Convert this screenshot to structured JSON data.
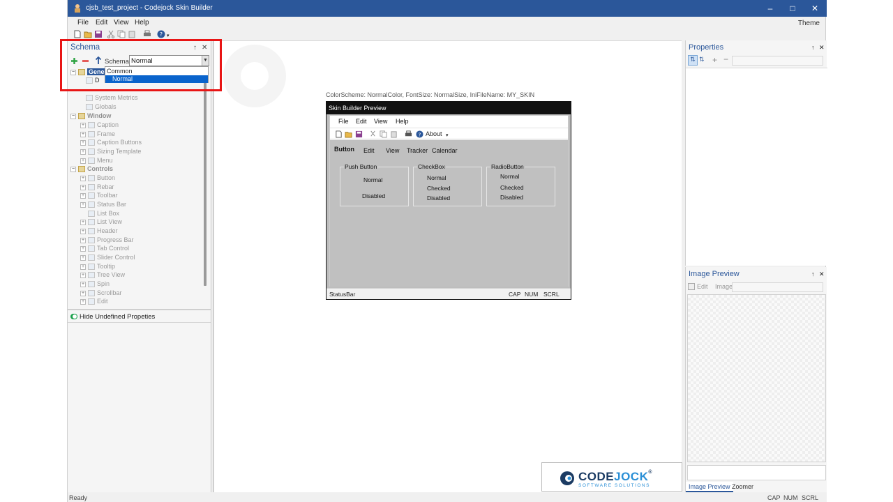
{
  "window": {
    "title": "cjsb_test_project - Codejock Skin Builder",
    "minimize": "–",
    "maximize": "□",
    "close": "✕"
  },
  "menu": [
    "File",
    "Edit",
    "View",
    "Help"
  ],
  "theme_label": "Theme",
  "schema_pane": {
    "title": "Schema",
    "pin": "↑",
    "close": "✕",
    "schema_label": "Schema:",
    "schema_value": "Normal",
    "dropdown_options": [
      "Common",
      "Normal"
    ],
    "tree": {
      "general_selected": "Gene",
      "child_partial": "D",
      "system_metrics": "System Metrics",
      "globals": "Globals",
      "window_group": "Window",
      "window_items": [
        "Caption",
        "Frame",
        "Caption Buttons",
        "Sizing Template",
        "Menu"
      ],
      "controls_group": "Controls",
      "control_items": [
        "Button",
        "Rebar",
        "Toolbar",
        "Status Bar",
        "List Box",
        "List View",
        "Header",
        "Progress Bar",
        "Tab Control",
        "Slider Control",
        "Tooltip",
        "Tree View",
        "Spin",
        "Scrollbar",
        "Edit"
      ]
    },
    "hide_undefined": "Hide Undefined Propeties"
  },
  "center": {
    "color_scheme": "ColorScheme: NormalColor, FontSize: NormalSize, IniFileName: MY_SKIN",
    "preview": {
      "title": "Skin Builder Preview",
      "menu": [
        "File",
        "Edit",
        "View",
        "Help"
      ],
      "about": "About",
      "tabs": [
        "Button",
        "Edit",
        "View",
        "Tracker",
        "Calendar"
      ],
      "push_button": {
        "title": "Push Button",
        "items": [
          "Normal",
          "Disabled"
        ]
      },
      "checkbox": {
        "title": "CheckBox",
        "items": [
          "Normal",
          "Checked",
          "Disabled"
        ]
      },
      "radio": {
        "title": "RadioButton",
        "items": [
          "Normal",
          "Checked",
          "Disabled"
        ]
      },
      "status": {
        "left": "StatusBar",
        "cap": "CAP",
        "num": "NUM",
        "scrl": "SCRL"
      }
    },
    "logo": {
      "code": "CODE",
      "jock": "JOCK",
      "registered": "®",
      "sub": "SOFTWARE SOLUTIONS"
    }
  },
  "properties_pane": {
    "title": "Properties",
    "pin": "↑",
    "close": "✕"
  },
  "image_preview_pane": {
    "title": "Image Preview",
    "pin": "↑",
    "close": "✕",
    "edit": "Edit",
    "image_label": "Image:",
    "tabs": [
      "Image Preview",
      "Zoomer"
    ]
  },
  "statusbar": {
    "left": "Ready",
    "cap": "CAP",
    "num": "NUM",
    "scrl": "SCRL"
  }
}
